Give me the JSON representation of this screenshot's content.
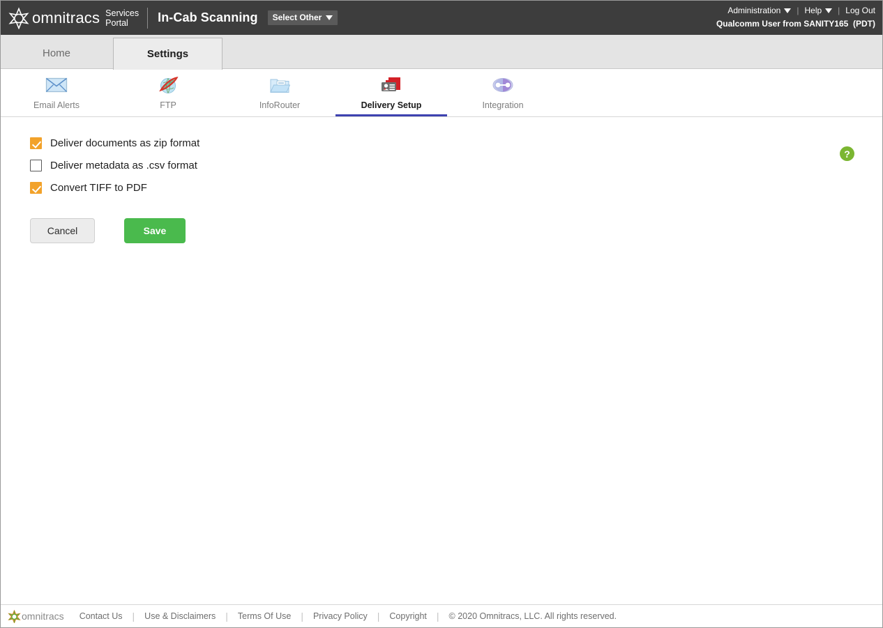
{
  "header": {
    "brand_name": "omnitracs",
    "brand_sub": "Services\nPortal",
    "app_title": "In-Cab Scanning",
    "select_other_label": "Select Other",
    "administration_label": "Administration",
    "help_label": "Help",
    "logout_label": "Log Out",
    "user_line": "Qualcomm User from SANITY165  (PDT)"
  },
  "tabs": [
    {
      "label": "Home",
      "active": false
    },
    {
      "label": "Settings",
      "active": true
    }
  ],
  "subnav": [
    {
      "label": "Email Alerts",
      "icon": "email-envelope-icon",
      "active": false
    },
    {
      "label": "FTP",
      "icon": "globe-ftp-icon",
      "active": false
    },
    {
      "label": "InfoRouter",
      "icon": "folder-documents-icon",
      "active": false
    },
    {
      "label": "Delivery Setup",
      "icon": "id-card-folder-icon",
      "active": true
    },
    {
      "label": "Integration",
      "icon": "connected-nodes-icon",
      "active": false
    }
  ],
  "settings": {
    "checkboxes": [
      {
        "label": "Deliver documents as zip format",
        "checked": true
      },
      {
        "label": "Deliver metadata as .csv format",
        "checked": false
      },
      {
        "label": "Convert TIFF to PDF",
        "checked": true
      }
    ],
    "cancel_label": "Cancel",
    "save_label": "Save",
    "help_glyph": "?"
  },
  "footer": {
    "brand_name": "omnitracs",
    "links": [
      "Contact Us",
      "Use & Disclaimers",
      "Terms Of Use",
      "Privacy Policy",
      "Copyright"
    ],
    "copyright": "© 2020 Omnitracs, LLC. All rights reserved."
  },
  "colors": {
    "topbar_bg": "#3d3d3d",
    "accent_underline": "#3d42b0",
    "checkbox_checked": "#f2a22a",
    "save_green": "#4aba4d",
    "help_green": "#7bb631"
  }
}
